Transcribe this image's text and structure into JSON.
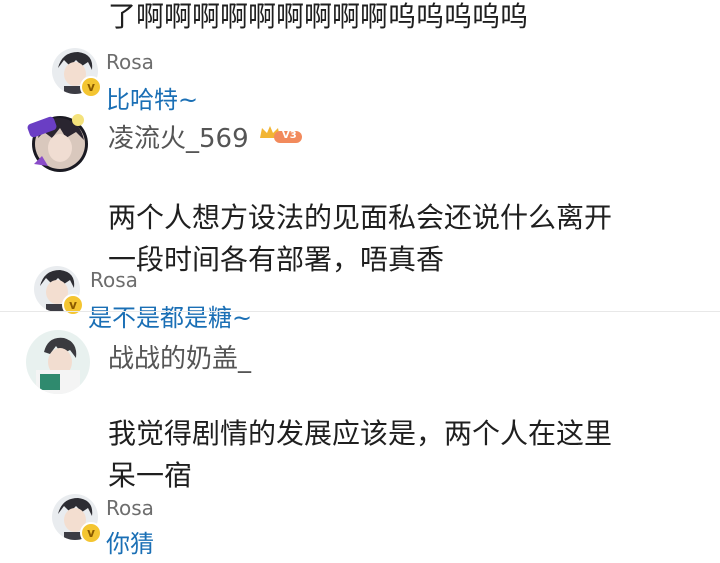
{
  "top_line": "了啊啊啊啊啊啊啊啊啊呜呜呜呜呜",
  "reply1": {
    "user": "Rosa",
    "text": "比哈特~"
  },
  "comment1": {
    "user": "凌流火_569",
    "avatar_badge": "iKUN",
    "level": "V3",
    "text_lines": [
      "两个人想方设法的见面私会还说什么离开",
      "一段时间各有部署，唔真香"
    ]
  },
  "reply2": {
    "user": "Rosa",
    "text": "是不是都是糖~"
  },
  "comment2": {
    "user": "战战的奶盖_",
    "text_lines": [
      "我觉得剧情的发展应该是，两个人在这里",
      "呆一宿"
    ]
  },
  "reply3": {
    "user": "Rosa",
    "text": "你猜"
  },
  "colors": {
    "reply_link": "#1a6fb5",
    "username": "#6d6d6d",
    "vip_gold": "#f4c531"
  }
}
